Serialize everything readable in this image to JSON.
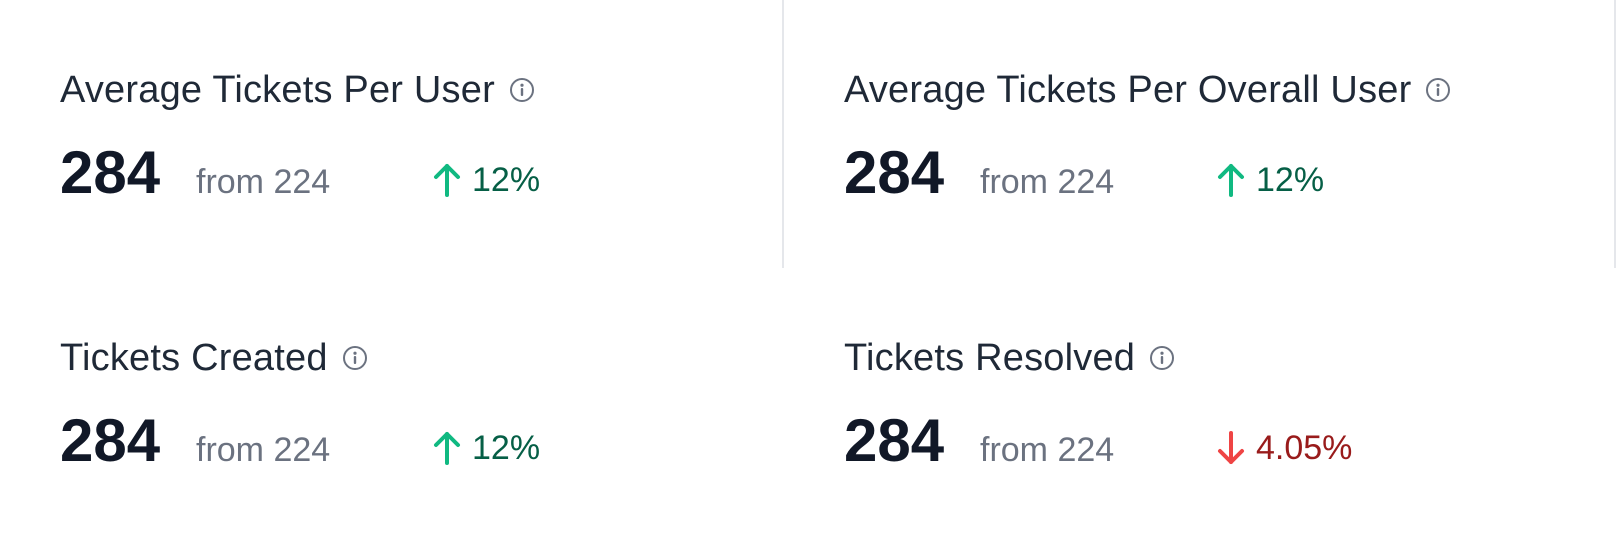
{
  "colors": {
    "up_arrow": "#10b981",
    "up_text": "#065f46",
    "down_arrow": "#ef4444",
    "down_text": "#991b1b",
    "muted": "#6b7280",
    "title": "#1f2937",
    "metric": "#111827"
  },
  "cards": [
    {
      "title": "Average Tickets Per User",
      "info_icon": "info-circle-icon",
      "value": "284",
      "from_text": "from 224",
      "change": "12%",
      "direction": "up",
      "arrow_icon": "arrow-up-icon"
    },
    {
      "title": "Average Tickets Per Overall User",
      "info_icon": "info-circle-icon",
      "value": "284",
      "from_text": "from 224",
      "change": "12%",
      "direction": "up",
      "arrow_icon": "arrow-up-icon"
    },
    {
      "title": "Tickets Created",
      "info_icon": "info-circle-icon",
      "value": "284",
      "from_text": "from 224",
      "change": "12%",
      "direction": "up",
      "arrow_icon": "arrow-up-icon"
    },
    {
      "title": "Tickets Resolved",
      "info_icon": "info-circle-icon",
      "value": "284",
      "from_text": "from 224",
      "change": "4.05%",
      "direction": "down",
      "arrow_icon": "arrow-down-icon"
    }
  ]
}
